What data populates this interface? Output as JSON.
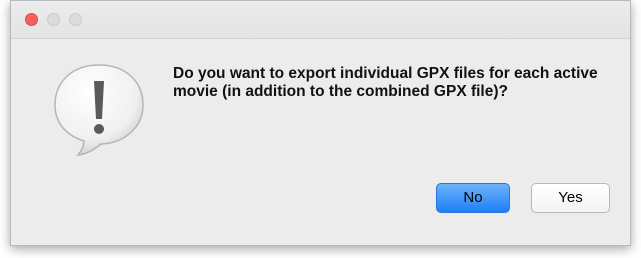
{
  "dialog": {
    "message": "Do you want to export individual GPX files for each active movie (in addition to the combined GPX file)?",
    "icon": "exclamation-bubble-icon",
    "buttons": {
      "no_label": "No",
      "yes_label": "Yes",
      "default": "No"
    }
  },
  "titlebar": {
    "controls": [
      "close",
      "minimize",
      "zoom"
    ]
  },
  "colors": {
    "close": "#fc605b",
    "inactive_control": "#dcdcdc",
    "default_button": "#1d7ff6",
    "window_bg": "#ececec"
  }
}
